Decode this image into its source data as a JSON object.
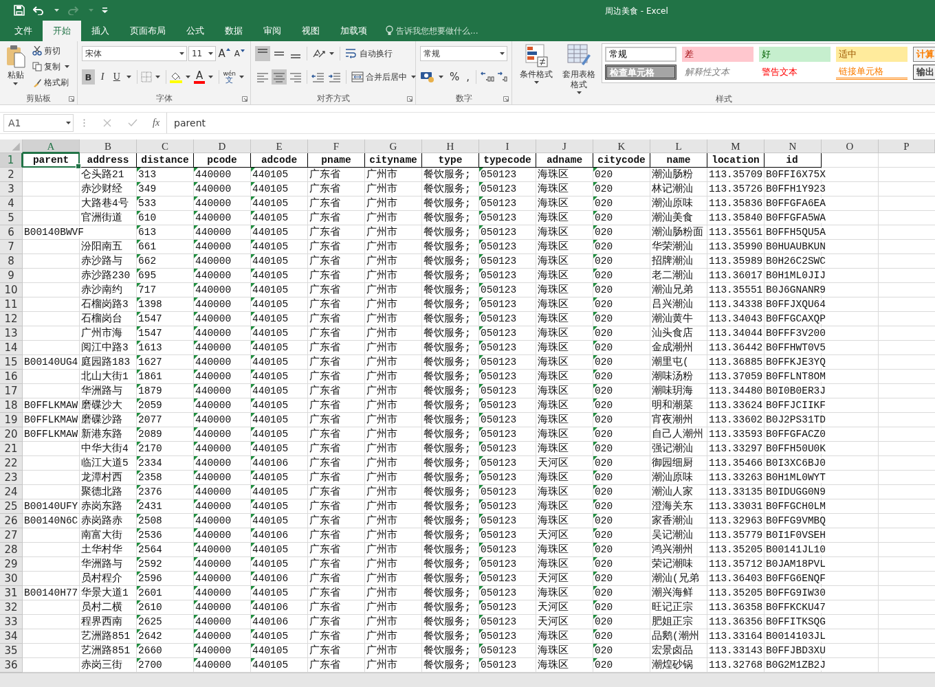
{
  "window": {
    "title": "周边美食 - Excel"
  },
  "ribbon_tabs": [
    {
      "label": "文件",
      "selected": false
    },
    {
      "label": "开始",
      "selected": true
    },
    {
      "label": "插入",
      "selected": false
    },
    {
      "label": "页面布局",
      "selected": false
    },
    {
      "label": "公式",
      "selected": false
    },
    {
      "label": "数据",
      "selected": false
    },
    {
      "label": "审阅",
      "selected": false
    },
    {
      "label": "视图",
      "selected": false
    },
    {
      "label": "加载项",
      "selected": false
    }
  ],
  "tell_me": {
    "placeholder": "告诉我您想要做什么..."
  },
  "clipboard": {
    "paste": "粘贴",
    "cut": "剪切",
    "copy": "复制",
    "format_painter": "格式刷",
    "label": "剪贴板"
  },
  "font": {
    "name": "宋体",
    "size": "11",
    "grow": "A",
    "shrink": "A",
    "bold": {
      "label": "B",
      "selected": true
    },
    "italic": {
      "label": "I",
      "selected": false
    },
    "underline": {
      "label": "U",
      "selected": false
    },
    "font_color": "A",
    "phonetic_top": "wén",
    "phonetic_bottom": "文",
    "label": "字体"
  },
  "alignment": {
    "vertical": [
      {
        "selected": true
      },
      {
        "selected": false
      },
      {
        "selected": false
      }
    ],
    "horizontal": [
      {
        "selected": false
      },
      {
        "selected": true
      },
      {
        "selected": false
      }
    ],
    "wrap": "自动换行",
    "merge": "合并后居中",
    "label": "对齐方式"
  },
  "number": {
    "format": "常规",
    "percent": "%",
    "comma": ",",
    "label": "数字"
  },
  "styles": {
    "conditional": "条件格式",
    "table": "套用表格格式",
    "label": "样式",
    "items": [
      {
        "label": "常规",
        "kind": "normal"
      },
      {
        "label": "差",
        "kind": "bad"
      },
      {
        "label": "好",
        "kind": "good"
      },
      {
        "label": "适中",
        "kind": "neutral"
      },
      {
        "label": "计算",
        "kind": "calculation"
      },
      {
        "label": "检查单元格",
        "kind": "check"
      },
      {
        "label": "解释性文本",
        "kind": "explanatory"
      },
      {
        "label": "警告文本",
        "kind": "warning"
      },
      {
        "label": "链接单元格",
        "kind": "linked"
      },
      {
        "label": "输出",
        "kind": "output"
      }
    ]
  },
  "formula_bar": {
    "name_box": "A1",
    "fx": "fx",
    "value": "parent"
  },
  "sheet": {
    "columns": [
      {
        "letter": "A",
        "selected": true,
        "number_as_text": false
      },
      {
        "letter": "B",
        "selected": false,
        "number_as_text": false
      },
      {
        "letter": "C",
        "selected": false,
        "number_as_text": true
      },
      {
        "letter": "D",
        "selected": false,
        "number_as_text": true
      },
      {
        "letter": "E",
        "selected": false,
        "number_as_text": true
      },
      {
        "letter": "F",
        "selected": false,
        "number_as_text": false
      },
      {
        "letter": "G",
        "selected": false,
        "number_as_text": false
      },
      {
        "letter": "H",
        "selected": false,
        "number_as_text": false
      },
      {
        "letter": "I",
        "selected": false,
        "number_as_text": true
      },
      {
        "letter": "J",
        "selected": false,
        "number_as_text": false
      },
      {
        "letter": "K",
        "selected": false,
        "number_as_text": true
      },
      {
        "letter": "L",
        "selected": false,
        "number_as_text": false
      },
      {
        "letter": "M",
        "selected": false,
        "number_as_text": false
      },
      {
        "letter": "N",
        "selected": false,
        "number_as_text": false
      },
      {
        "letter": "O",
        "selected": false
      },
      {
        "letter": "P",
        "selected": false
      }
    ],
    "rows": [
      {
        "number": "1",
        "selected": true,
        "kind": "header",
        "cells": [
          "parent",
          "address",
          "distance",
          "pcode",
          "adcode",
          "pname",
          "cityname",
          "type",
          "typecode",
          "adname",
          "citycode",
          "name",
          "location",
          "id"
        ]
      },
      {
        "number": "2",
        "selected": false,
        "kind": "data",
        "cells": [
          null,
          "仑头路21",
          "313",
          "440000",
          "440105",
          "广东省",
          "广州市",
          "餐饮服务;",
          "050123",
          "海珠区",
          "020",
          "潮汕肠粉",
          "113.35709",
          "B0FFI6X75X"
        ]
      },
      {
        "number": "3",
        "selected": false,
        "kind": "data",
        "cells": [
          null,
          "赤沙财经",
          "349",
          "440000",
          "440105",
          "广东省",
          "广州市",
          "餐饮服务;",
          "050123",
          "海珠区",
          "020",
          "林记潮汕",
          "113.35726",
          "B0FFH1Y923"
        ]
      },
      {
        "number": "4",
        "selected": false,
        "kind": "data",
        "cells": [
          null,
          "大路巷4号",
          "533",
          "440000",
          "440105",
          "广东省",
          "广州市",
          "餐饮服务;",
          "050123",
          "海珠区",
          "020",
          "潮汕原味",
          "113.35836",
          "B0FFGFA6EA"
        ]
      },
      {
        "number": "5",
        "selected": false,
        "kind": "data",
        "cells": [
          null,
          "官洲街道",
          "610",
          "440000",
          "440105",
          "广东省",
          "广州市",
          "餐饮服务;",
          "050123",
          "海珠区",
          "020",
          "潮汕美食",
          "113.35840",
          "B0FFGFA5WA"
        ]
      },
      {
        "number": "6",
        "selected": false,
        "kind": "data",
        "cells": [
          "B00140BWVF",
          null,
          "613",
          "440000",
          "440105",
          "广东省",
          "广州市",
          "餐饮服务;",
          "050123",
          "海珠区",
          "020",
          "潮汕肠粉面",
          "113.35561",
          "B0FFH5QU5A"
        ]
      },
      {
        "number": "7",
        "selected": false,
        "kind": "data",
        "cells": [
          null,
          "汾阳南五",
          "661",
          "440000",
          "440105",
          "广东省",
          "广州市",
          "餐饮服务;",
          "050123",
          "海珠区",
          "020",
          "华荣潮汕",
          "113.35990",
          "B0HUAUBKUN"
        ]
      },
      {
        "number": "8",
        "selected": false,
        "kind": "data",
        "cells": [
          null,
          "赤沙路与",
          "662",
          "440000",
          "440105",
          "广东省",
          "广州市",
          "餐饮服务;",
          "050123",
          "海珠区",
          "020",
          "招牌潮汕",
          "113.35989",
          "B0H26C2SWC"
        ]
      },
      {
        "number": "9",
        "selected": false,
        "kind": "data",
        "cells": [
          null,
          "赤沙路230",
          "695",
          "440000",
          "440105",
          "广东省",
          "广州市",
          "餐饮服务;",
          "050123",
          "海珠区",
          "020",
          "老二潮汕",
          "113.36017",
          "B0H1ML0JIJ"
        ]
      },
      {
        "number": "10",
        "selected": false,
        "kind": "data",
        "cells": [
          null,
          "赤沙南约",
          "717",
          "440000",
          "440105",
          "广东省",
          "广州市",
          "餐饮服务;",
          "050123",
          "海珠区",
          "020",
          "潮汕兄弟",
          "113.35551",
          "B0J6GNANR9"
        ]
      },
      {
        "number": "11",
        "selected": false,
        "kind": "data",
        "cells": [
          null,
          "石榴岗路3",
          "1398",
          "440000",
          "440105",
          "广东省",
          "广州市",
          "餐饮服务;",
          "050123",
          "海珠区",
          "020",
          "吕兴潮汕",
          "113.34338",
          "B0FFJXQU64"
        ]
      },
      {
        "number": "12",
        "selected": false,
        "kind": "data",
        "cells": [
          null,
          "石榴岗台",
          "1547",
          "440000",
          "440105",
          "广东省",
          "广州市",
          "餐饮服务;",
          "050123",
          "海珠区",
          "020",
          "潮汕黄牛",
          "113.34043",
          "B0FFGCAXQP"
        ]
      },
      {
        "number": "13",
        "selected": false,
        "kind": "data",
        "cells": [
          null,
          "广州市海",
          "1547",
          "440000",
          "440105",
          "广东省",
          "广州市",
          "餐饮服务;",
          "050123",
          "海珠区",
          "020",
          "汕头食店",
          "113.34044",
          "B0FFF3V200"
        ]
      },
      {
        "number": "14",
        "selected": false,
        "kind": "data",
        "cells": [
          null,
          "阅江中路3",
          "1613",
          "440000",
          "440105",
          "广东省",
          "广州市",
          "餐饮服务;",
          "050123",
          "海珠区",
          "020",
          "金成潮州",
          "113.36442",
          "B0FFHWT0V5"
        ]
      },
      {
        "number": "15",
        "selected": false,
        "kind": "data",
        "cells": [
          "B00140UG4",
          "庭园路183",
          "1627",
          "440000",
          "440105",
          "广东省",
          "广州市",
          "餐饮服务;",
          "050123",
          "海珠区",
          "020",
          "潮里屯(",
          "113.36885",
          "B0FFKJE3YQ"
        ]
      },
      {
        "number": "16",
        "selected": false,
        "kind": "data",
        "cells": [
          null,
          "北山大街1",
          "1861",
          "440000",
          "440105",
          "广东省",
          "广州市",
          "餐饮服务;",
          "050123",
          "海珠区",
          "020",
          "潮味汤粉",
          "113.37059",
          "B0FFLNT8OM"
        ]
      },
      {
        "number": "17",
        "selected": false,
        "kind": "data",
        "cells": [
          null,
          "华洲路与",
          "1879",
          "440000",
          "440105",
          "广东省",
          "广州市",
          "餐饮服务;",
          "050123",
          "海珠区",
          "020",
          "潮味玥海",
          "113.34480",
          "B0I0B0ER3J"
        ]
      },
      {
        "number": "18",
        "selected": false,
        "kind": "data",
        "cells": [
          "B0FFLKMAW",
          "磨碟沙大",
          "2059",
          "440000",
          "440105",
          "广东省",
          "广州市",
          "餐饮服务;",
          "050123",
          "海珠区",
          "020",
          "明和潮菜",
          "113.33624",
          "B0FFJCIIKF"
        ]
      },
      {
        "number": "19",
        "selected": false,
        "kind": "data",
        "cells": [
          "B0FFLKMAW",
          "磨碟沙路",
          "2077",
          "440000",
          "440105",
          "广东省",
          "广州市",
          "餐饮服务;",
          "050123",
          "海珠区",
          "020",
          "宵夜潮州",
          "113.33602",
          "B0J2PS31TD"
        ]
      },
      {
        "number": "20",
        "selected": false,
        "kind": "data",
        "cells": [
          "B0FFLKMAW",
          "新港东路",
          "2089",
          "440000",
          "440105",
          "广东省",
          "广州市",
          "餐饮服务;",
          "050123",
          "海珠区",
          "020",
          "自己人潮州",
          "113.33593",
          "B0FFGFACZ0"
        ]
      },
      {
        "number": "21",
        "selected": false,
        "kind": "data",
        "cells": [
          null,
          "中华大街4",
          "2170",
          "440000",
          "440105",
          "广东省",
          "广州市",
          "餐饮服务;",
          "050123",
          "海珠区",
          "020",
          "强记潮汕",
          "113.33297",
          "B0FFH50U0K"
        ]
      },
      {
        "number": "22",
        "selected": false,
        "kind": "data",
        "cells": [
          null,
          "临江大道5",
          "2334",
          "440000",
          "440106",
          "广东省",
          "广州市",
          "餐饮服务;",
          "050123",
          "天河区",
          "020",
          "御园细厨",
          "113.35466",
          "B0I3XC6BJ0"
        ]
      },
      {
        "number": "23",
        "selected": false,
        "kind": "data",
        "cells": [
          null,
          "龙潭村西",
          "2358",
          "440000",
          "440105",
          "广东省",
          "广州市",
          "餐饮服务;",
          "050123",
          "海珠区",
          "020",
          "潮汕原味",
          "113.33263",
          "B0H1ML0WYT"
        ]
      },
      {
        "number": "24",
        "selected": false,
        "kind": "data",
        "cells": [
          null,
          "聚德北路",
          "2376",
          "440000",
          "440105",
          "广东省",
          "广州市",
          "餐饮服务;",
          "050123",
          "海珠区",
          "020",
          "潮汕人家",
          "113.33135",
          "B0IDUGG0N9"
        ]
      },
      {
        "number": "25",
        "selected": false,
        "kind": "data",
        "cells": [
          "B00140UFY",
          "赤岗东路",
          "2431",
          "440000",
          "440105",
          "广东省",
          "广州市",
          "餐饮服务;",
          "050123",
          "海珠区",
          "020",
          "澄海关东",
          "113.33031",
          "B0FFGCH0LM"
        ]
      },
      {
        "number": "26",
        "selected": false,
        "kind": "data",
        "cells": [
          "B00140N6C",
          "赤岗路赤",
          "2508",
          "440000",
          "440105",
          "广东省",
          "广州市",
          "餐饮服务;",
          "050123",
          "海珠区",
          "020",
          "家香潮汕",
          "113.32963",
          "B0FFG9VMBQ"
        ]
      },
      {
        "number": "27",
        "selected": false,
        "kind": "data",
        "cells": [
          null,
          "南富大街",
          "2536",
          "440000",
          "440106",
          "广东省",
          "广州市",
          "餐饮服务;",
          "050123",
          "天河区",
          "020",
          "吴记潮汕",
          "113.35779",
          "B0I1F0VSEH"
        ]
      },
      {
        "number": "28",
        "selected": false,
        "kind": "data",
        "cells": [
          null,
          "土华村华",
          "2564",
          "440000",
          "440105",
          "广东省",
          "广州市",
          "餐饮服务;",
          "050123",
          "海珠区",
          "020",
          "鸿兴潮州",
          "113.35205",
          "B00141JL10"
        ]
      },
      {
        "number": "29",
        "selected": false,
        "kind": "data",
        "cells": [
          null,
          "华洲路与",
          "2592",
          "440000",
          "440105",
          "广东省",
          "广州市",
          "餐饮服务;",
          "050123",
          "海珠区",
          "020",
          "荣记潮味",
          "113.35712",
          "B0JAM18PVL"
        ]
      },
      {
        "number": "30",
        "selected": false,
        "kind": "data",
        "cells": [
          null,
          "员村程介",
          "2596",
          "440000",
          "440106",
          "广东省",
          "广州市",
          "餐饮服务;",
          "050123",
          "天河区",
          "020",
          "潮汕(兄弟",
          "113.36403",
          "B0FFG6ENQF"
        ]
      },
      {
        "number": "31",
        "selected": false,
        "kind": "data",
        "cells": [
          "B00140H77",
          "华景大道1",
          "2601",
          "440000",
          "440105",
          "广东省",
          "广州市",
          "餐饮服务;",
          "050123",
          "海珠区",
          "020",
          "潮兴海鲜",
          "113.35205",
          "B0FFG9IW30"
        ]
      },
      {
        "number": "32",
        "selected": false,
        "kind": "data",
        "cells": [
          null,
          "员村二横",
          "2610",
          "440000",
          "440106",
          "广东省",
          "广州市",
          "餐饮服务;",
          "050123",
          "天河区",
          "020",
          "旺记正宗",
          "113.36358",
          "B0FFKCKU47"
        ]
      },
      {
        "number": "33",
        "selected": false,
        "kind": "data",
        "cells": [
          null,
          "程界西南",
          "2625",
          "440000",
          "440106",
          "广东省",
          "广州市",
          "餐饮服务;",
          "050123",
          "天河区",
          "020",
          "肥姐正宗",
          "113.36356",
          "B0FFITKSQG"
        ]
      },
      {
        "number": "34",
        "selected": false,
        "kind": "data",
        "cells": [
          null,
          "艺洲路851",
          "2642",
          "440000",
          "440105",
          "广东省",
          "广州市",
          "餐饮服务;",
          "050123",
          "海珠区",
          "020",
          "品鹅(潮州",
          "113.33164",
          "B0014103JL"
        ]
      },
      {
        "number": "35",
        "selected": false,
        "kind": "data",
        "cells": [
          null,
          "艺洲路851",
          "2660",
          "440000",
          "440105",
          "广东省",
          "广州市",
          "餐饮服务;",
          "050123",
          "海珠区",
          "020",
          "宏景卤品",
          "113.33143",
          "B0FFJBD3XU"
        ]
      },
      {
        "number": "36",
        "selected": false,
        "kind": "data",
        "cells": [
          null,
          "赤岗三街",
          "2700",
          "440000",
          "440105",
          "广东省",
          "广州市",
          "餐饮服务;",
          "050123",
          "海珠区",
          "020",
          "潮煌砂锅",
          "113.32768",
          "B0G2M1ZB2J"
        ]
      }
    ]
  }
}
